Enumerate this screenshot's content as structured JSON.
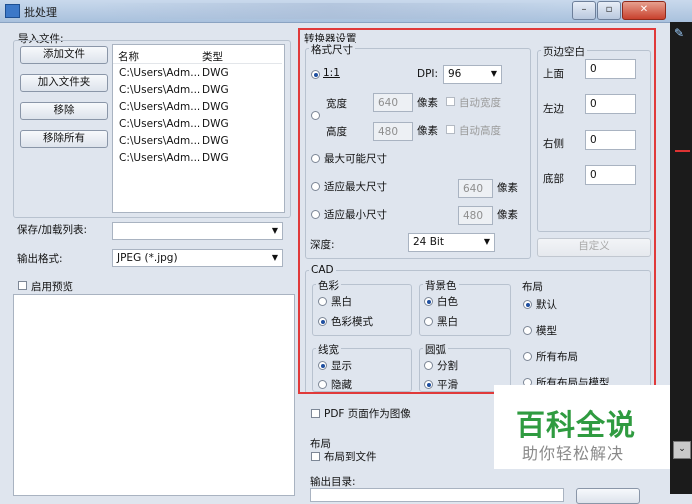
{
  "window": {
    "title": "批处理",
    "btn_min": "–",
    "btn_max": "▫",
    "btn_close": "✕"
  },
  "import": {
    "label": "导入文件:",
    "buttons": [
      "添加文件",
      "加入文件夹",
      "移除",
      "移除所有"
    ],
    "columns": [
      "名称",
      "类型"
    ],
    "files": [
      {
        "name": "C:\\Users\\Adm...",
        "type": "DWG"
      },
      {
        "name": "C:\\Users\\Adm...",
        "type": "DWG"
      },
      {
        "name": "C:\\Users\\Adm...",
        "type": "DWG"
      },
      {
        "name": "C:\\Users\\Adm...",
        "type": "DWG"
      },
      {
        "name": "C:\\Users\\Adm...",
        "type": "DWG"
      },
      {
        "name": "C:\\Users\\Adm...",
        "type": "DWG"
      }
    ]
  },
  "save_load": {
    "label": "保存/加载列表:",
    "value": ""
  },
  "output_format": {
    "label": "输出格式:",
    "value": "JPEG (*.jpg)"
  },
  "preview": {
    "label": "启用预览",
    "checked": false
  },
  "converter": {
    "title": "转换器设置",
    "format_size": {
      "title": "格式尺寸",
      "ratio_label": "1:1",
      "dpi_label": "DPI:",
      "dpi_value": "96",
      "width_label": "宽度",
      "width_value": "640",
      "height_label": "高度",
      "height_value": "480",
      "pixel_label": "像素",
      "auto_width": "自动宽度",
      "auto_height": "自动高度",
      "max_possible": "最大可能尺寸",
      "fit_max": "适应最大尺寸",
      "fit_max_value": "640",
      "fit_min": "适应最小尺寸",
      "fit_min_value": "480",
      "depth_label": "深度:",
      "depth_value": "24 Bit"
    },
    "margins": {
      "title": "页边空白",
      "top_label": "上面",
      "top_value": "0",
      "left_label": "左边",
      "left_value": "0",
      "right_label": "右侧",
      "right_value": "0",
      "bottom_label": "底部",
      "bottom_value": "0",
      "custom_button": "自定义"
    },
    "cad": {
      "title": "CAD",
      "color": {
        "title": "色彩",
        "bw": "黑白",
        "color_mode": "色彩模式",
        "selected": "色彩模式"
      },
      "background": {
        "title": "背景色",
        "white": "白色",
        "black": "黑白",
        "selected": "白色"
      },
      "layout": {
        "title": "布局",
        "default": "默认",
        "model": "模型",
        "all_layouts": "所有布局",
        "all_layouts_model": "所有布局与模型",
        "selected": "默认"
      },
      "lineweight": {
        "title": "线宽",
        "show": "显示",
        "hide": "隐藏",
        "selected": "显示"
      },
      "arc": {
        "title": "圆弧",
        "split": "分割",
        "smooth": "平滑",
        "selected": "平滑"
      }
    }
  },
  "pdf_as_image": {
    "label": "PDF 页面作为图像",
    "checked": false
  },
  "layout_section": {
    "title": "布局",
    "layout_to_file": "布局到文件",
    "checked": false
  },
  "output_dir": {
    "label": "输出目录:"
  },
  "watermark": {
    "title": "百科全说",
    "subtitle": "助你轻松解决"
  },
  "colors": {
    "accent_frame": "#e03a3a",
    "watermark_green": "#2f9b40",
    "window_bg": "#dfe5ee"
  }
}
